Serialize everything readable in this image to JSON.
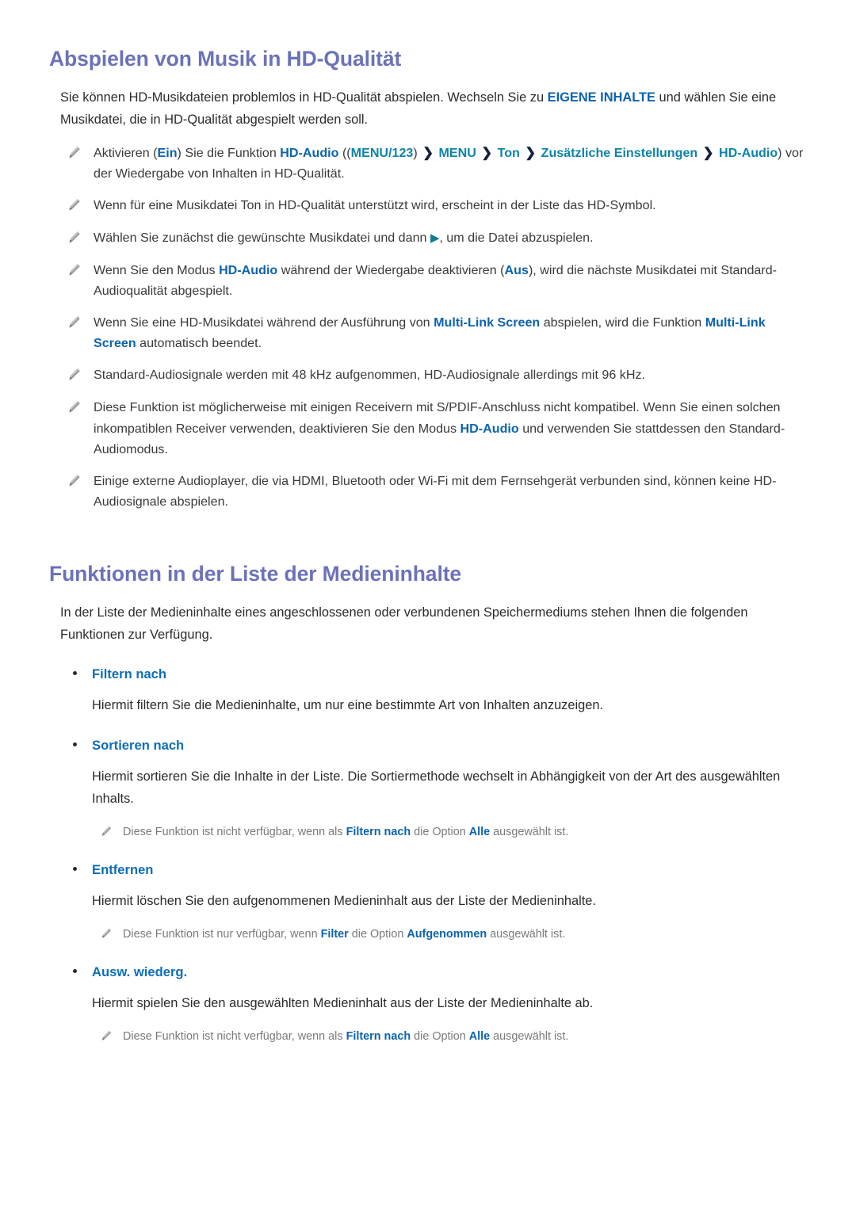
{
  "document": {
    "sections": [
      {
        "id": "hd-music",
        "title": "Abspielen von Musik in HD-Qualität",
        "intro_prefix": "Sie können HD-Musikdateien problemlos in HD-Qualität abspielen. Wechseln Sie zu ",
        "intro_emphasis": "EIGENE INHALTE",
        "intro_suffix": " und wählen Sie eine Musikdatei, die in HD-Qualität abgespielt werden soll.",
        "notes": [
          {
            "id": "note-activate-hd-audio",
            "icon": "pencil-icon",
            "segments": [
              {
                "t": "Aktivieren (",
                "s": "plain"
              },
              {
                "t": "Ein",
                "s": "blue"
              },
              {
                "t": ") Sie die Funktion ",
                "s": "plain"
              },
              {
                "t": "HD-Audio",
                "s": "blue"
              },
              {
                "t": " ((",
                "s": "plain"
              },
              {
                "t": "MENU/123",
                "s": "teal"
              },
              {
                "t": ") ",
                "s": "plain"
              },
              {
                "t": "❯",
                "s": "chevron"
              },
              {
                "t": " ",
                "s": "plain"
              },
              {
                "t": "MENU",
                "s": "teal"
              },
              {
                "t": " ",
                "s": "plain"
              },
              {
                "t": "❯",
                "s": "chevron"
              },
              {
                "t": " ",
                "s": "plain"
              },
              {
                "t": "Ton",
                "s": "teal"
              },
              {
                "t": " ",
                "s": "plain"
              },
              {
                "t": "❯",
                "s": "chevron"
              },
              {
                "t": " ",
                "s": "plain"
              },
              {
                "t": "Zusätzliche Einstellungen",
                "s": "teal"
              },
              {
                "t": " ",
                "s": "plain"
              },
              {
                "t": "❯",
                "s": "chevron"
              },
              {
                "t": " ",
                "s": "plain"
              },
              {
                "t": "HD-Audio",
                "s": "teal"
              },
              {
                "t": ") vor der Wiedergabe von Inhalten in HD-Qualität.",
                "s": "plain"
              }
            ]
          },
          {
            "id": "note-hd-symbol",
            "icon": "pencil-icon",
            "segments": [
              {
                "t": "Wenn für eine Musikdatei Ton in HD-Qualität unterstützt wird, erscheint in der Liste das HD-Symbol.",
                "s": "plain"
              }
            ]
          },
          {
            "id": "note-select-file",
            "icon": "pencil-icon",
            "segments": [
              {
                "t": "Wählen Sie zunächst die gewünschte Musikdatei und dann ",
                "s": "plain"
              },
              {
                "t": "▶",
                "s": "play"
              },
              {
                "t": ", um die Datei abzuspielen.",
                "s": "plain"
              }
            ]
          },
          {
            "id": "note-deactivate-hd-audio",
            "icon": "pencil-icon",
            "segments": [
              {
                "t": "Wenn Sie den Modus ",
                "s": "plain"
              },
              {
                "t": "HD-Audio",
                "s": "blue"
              },
              {
                "t": " während der Wiedergabe deaktivieren (",
                "s": "plain"
              },
              {
                "t": "Aus",
                "s": "blue"
              },
              {
                "t": "), wird die nächste Musikdatei mit Standard-Audioqualität abgespielt.",
                "s": "plain"
              }
            ]
          },
          {
            "id": "note-multi-link-screen",
            "icon": "pencil-icon",
            "segments": [
              {
                "t": "Wenn Sie eine HD-Musikdatei während der Ausführung von ",
                "s": "plain"
              },
              {
                "t": "Multi-Link Screen",
                "s": "blue"
              },
              {
                "t": " abspielen, wird die Funktion ",
                "s": "plain"
              },
              {
                "t": "Multi-Link Screen",
                "s": "blue"
              },
              {
                "t": " automatisch beendet.",
                "s": "plain"
              }
            ]
          },
          {
            "id": "note-sample-rates",
            "icon": "pencil-icon",
            "segments": [
              {
                "t": "Standard-Audiosignale werden mit 48 kHz aufgenommen, HD-Audiosignale allerdings mit 96 kHz.",
                "s": "plain"
              }
            ]
          },
          {
            "id": "note-spdif-compat",
            "icon": "pencil-icon",
            "segments": [
              {
                "t": "Diese Funktion ist möglicherweise mit einigen Receivern mit S/PDIF-Anschluss nicht kompatibel. Wenn Sie einen solchen inkompatiblen Receiver verwenden, deaktivieren Sie den Modus ",
                "s": "plain"
              },
              {
                "t": "HD-Audio",
                "s": "blue"
              },
              {
                "t": " und verwenden Sie stattdessen den Standard-Audiomodus.",
                "s": "plain"
              }
            ]
          },
          {
            "id": "note-external-players",
            "icon": "pencil-icon",
            "segments": [
              {
                "t": "Einige externe Audioplayer, die via HDMI, Bluetooth oder Wi-Fi mit dem Fernsehgerät verbunden sind, können keine HD-Audiosignale abspielen.",
                "s": "plain"
              }
            ]
          }
        ]
      },
      {
        "id": "media-list-functions",
        "title": "Funktionen in der Liste der Medieninhalte",
        "intro": "In der Liste der Medieninhalte eines angeschlossenen oder verbundenen Speichermediums stehen Ihnen die folgenden Funktionen zur Verfügung.",
        "features": [
          {
            "id": "feature-filtern-nach",
            "label": "Filtern nach",
            "body": "Hiermit filtern Sie die Medieninhalte, um nur eine bestimmte Art von Inhalten anzuzeigen.",
            "subnotes": []
          },
          {
            "id": "feature-sortieren-nach",
            "label": "Sortieren nach",
            "body": "Hiermit sortieren Sie die Inhalte in der Liste. Die Sortiermethode wechselt in Abhängigkeit von der Art des ausgewählten Inhalts.",
            "subnotes": [
              {
                "id": "subnote-sortieren",
                "icon": "pencil-icon",
                "segments": [
                  {
                    "t": "Diese Funktion ist nicht verfügbar, wenn als ",
                    "s": "plain"
                  },
                  {
                    "t": "Filtern nach",
                    "s": "blue"
                  },
                  {
                    "t": " die Option ",
                    "s": "plain"
                  },
                  {
                    "t": "Alle",
                    "s": "blue"
                  },
                  {
                    "t": " ausgewählt ist.",
                    "s": "plain"
                  }
                ]
              }
            ]
          },
          {
            "id": "feature-entfernen",
            "label": "Entfernen",
            "body": "Hiermit löschen Sie den aufgenommenen Medieninhalt aus der Liste der Medieninhalte.",
            "subnotes": [
              {
                "id": "subnote-entfernen",
                "icon": "pencil-icon",
                "segments": [
                  {
                    "t": "Diese Funktion ist nur verfügbar, wenn ",
                    "s": "plain"
                  },
                  {
                    "t": "Filter",
                    "s": "blue"
                  },
                  {
                    "t": " die Option ",
                    "s": "plain"
                  },
                  {
                    "t": "Aufgenommen",
                    "s": "blue"
                  },
                  {
                    "t": " ausgewählt ist.",
                    "s": "plain"
                  }
                ]
              }
            ]
          },
          {
            "id": "feature-ausw-wiederg",
            "label": "Ausw. wiederg.",
            "body": "Hiermit spielen Sie den ausgewählten Medieninhalt aus der Liste der Medieninhalte ab.",
            "subnotes": [
              {
                "id": "subnote-ausw-wiederg",
                "icon": "pencil-icon",
                "segments": [
                  {
                    "t": "Diese Funktion ist nicht verfügbar, wenn als ",
                    "s": "plain"
                  },
                  {
                    "t": "Filtern nach",
                    "s": "blue"
                  },
                  {
                    "t": " die Option ",
                    "s": "plain"
                  },
                  {
                    "t": "Alle",
                    "s": "blue"
                  },
                  {
                    "t": " ausgewählt ist.",
                    "s": "plain"
                  }
                ]
              }
            ]
          }
        ]
      }
    ]
  },
  "colors": {
    "heading": "#6b72b8",
    "emphasis_blue": "#0d63ad",
    "emphasis_teal": "#0d84a8",
    "body": "#2b2b2b",
    "subnote": "#7a7a7a",
    "play_icon": "#0f7e93"
  }
}
